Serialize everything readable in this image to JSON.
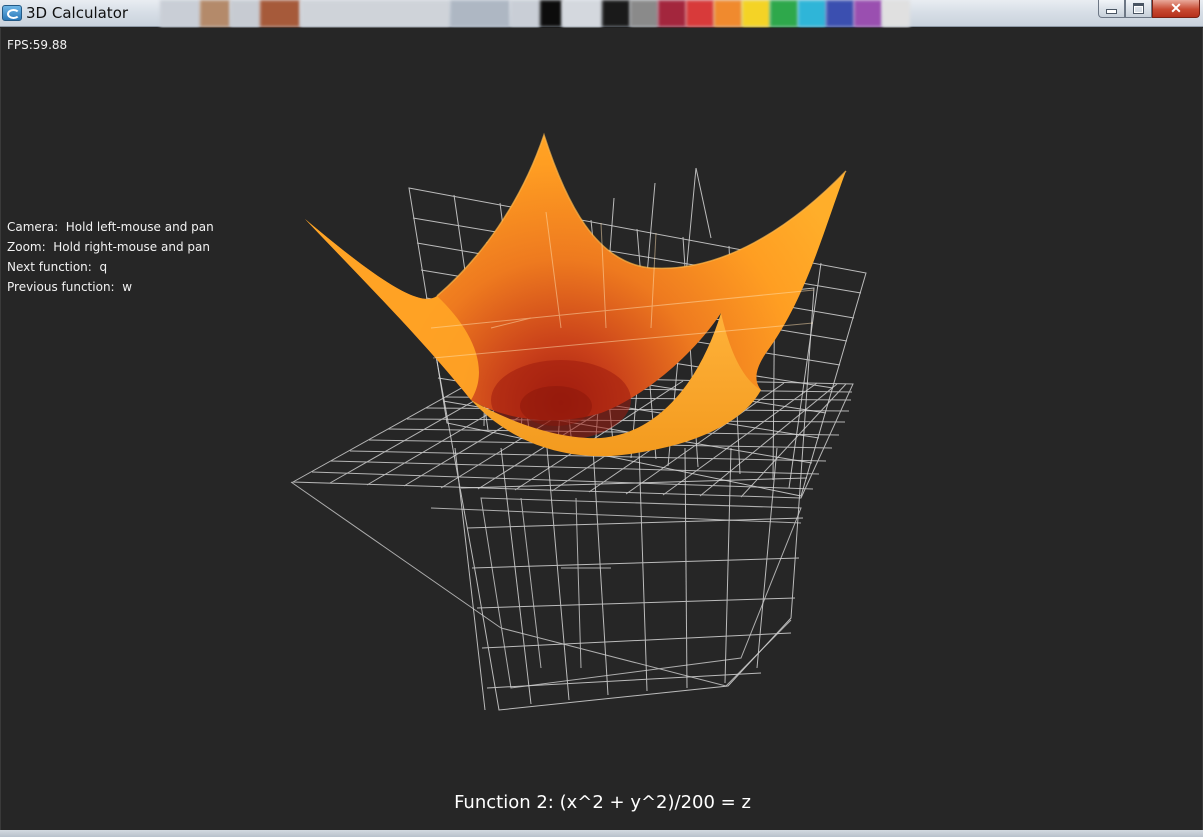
{
  "window": {
    "title": "3D Calculator",
    "controls": [
      "minimize",
      "maximize",
      "close"
    ],
    "close_glyph": "✕"
  },
  "overlay": {
    "fps": "FPS:59.88",
    "help": [
      "Camera:  Hold left-mouse and pan",
      "Zoom:  Hold right-mouse and pan",
      "Next function:  q",
      "Previous function:  w"
    ],
    "function_label": "Function 2: (x^2 + y^2)/200 = z"
  },
  "colors": {
    "background": "#262626",
    "grid": "#d8d8d8",
    "surface_light": "#ffa41f",
    "surface_dark": "#b52a12"
  },
  "icons": {
    "app": "calculator-app-icon",
    "minimize": "minimize-icon",
    "maximize": "maximize-icon",
    "close": "close-icon"
  }
}
